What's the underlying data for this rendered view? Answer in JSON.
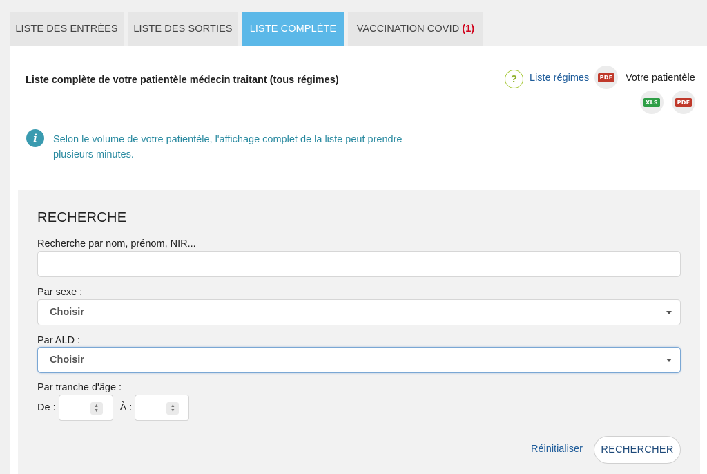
{
  "tabs": [
    {
      "label": "LISTE DES ENTRÉES",
      "count": ""
    },
    {
      "label": "LISTE DES SORTIES",
      "count": ""
    },
    {
      "label": "LISTE COMPLÈTE",
      "count": ""
    },
    {
      "label": "VACCINATION COVID",
      "count": "(1)"
    }
  ],
  "active_tab": "LISTE COMPLÈTE",
  "header": {
    "title": "Liste complète de votre patientèle médecin traitant (tous régimes)",
    "help_icon": "?",
    "regimes_link": "Liste régimes",
    "patientele_label": "Votre patientèle",
    "pdf_badge": "PDF",
    "xls_badge": "XLS"
  },
  "info": {
    "icon": "i",
    "text": "Selon le volume de votre patientèle, l'affichage complet de la liste peut prendre plusieurs minutes."
  },
  "search": {
    "title": "RECHERCHE",
    "name_label": "Recherche par nom, prénom, NIR...",
    "name_value": "",
    "sex_label": "Par sexe :",
    "sex_value": "Choisir",
    "ald_label": "Par ALD :",
    "ald_value": "Choisir",
    "age_label": "Par tranche d'âge :",
    "from_label": "De :",
    "to_label": "À :",
    "from_value": "",
    "to_value": "",
    "reset_label": "Réinitialiser",
    "submit_label": "RECHERCHER"
  },
  "colors": {
    "active_tab": "#5bb8e8",
    "link": "#1e5c9a",
    "info_text": "#2a8aa0",
    "covid_count": "#d0021b"
  }
}
